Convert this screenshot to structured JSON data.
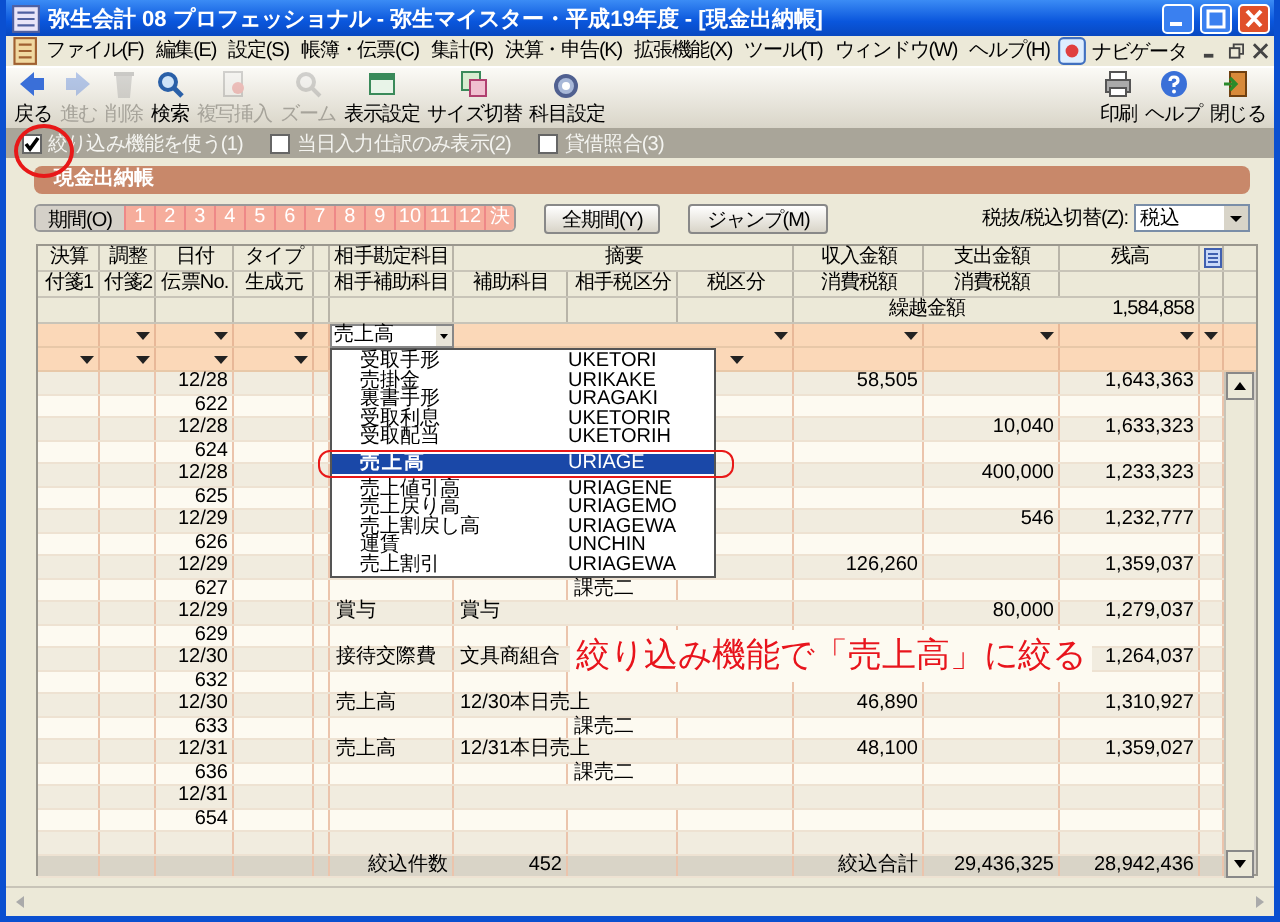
{
  "window": {
    "title": "弥生会計 08 プロフェッショナル - 弥生マイスター・平成19年度 - [現金出納帳]"
  },
  "menu": [
    "ファイル(F)",
    "編集(E)",
    "設定(S)",
    "帳簿・伝票(C)",
    "集計(R)",
    "決算・申告(K)",
    "拡張機能(X)",
    "ツール(T)",
    "ウィンドウ(W)",
    "ヘルプ(H)"
  ],
  "navigator": "ナビゲータ",
  "toolbar": [
    {
      "label": "戻る",
      "disabled": false
    },
    {
      "label": "進む",
      "disabled": true
    },
    {
      "label": "削除",
      "disabled": true
    },
    {
      "label": "検索",
      "disabled": false
    },
    {
      "label": "複写挿入",
      "disabled": true
    },
    {
      "label": "ズーム",
      "disabled": true
    },
    {
      "label": "表示設定",
      "disabled": false
    },
    {
      "label": "サイズ切替",
      "disabled": false
    },
    {
      "label": "科目設定",
      "disabled": false
    }
  ],
  "toolbar_right": [
    {
      "label": "印刷",
      "disabled": false
    },
    {
      "label": "ヘルプ",
      "disabled": false
    },
    {
      "label": "閉じる",
      "disabled": false
    }
  ],
  "options": [
    {
      "label": "絞り込み機能を使う(1)",
      "checked": true
    },
    {
      "label": "当日入力仕訳のみ表示(2)",
      "checked": false
    },
    {
      "label": "貸借照合(3)",
      "checked": false
    }
  ],
  "ledger_title": "現金出納帳",
  "period": {
    "label": "期間(O)",
    "months": [
      "1",
      "2",
      "3",
      "4",
      "5",
      "6",
      "7",
      "8",
      "9",
      "10",
      "11",
      "12",
      "決"
    ]
  },
  "period_buttons": [
    "全期間(Y)",
    "ジャンプ(M)"
  ],
  "tax_switch": {
    "label": "税抜/税込切替(Z):",
    "value": "税込"
  },
  "table": {
    "columns": [
      {
        "top": "決算",
        "bottom": "付箋1"
      },
      {
        "top": "調整",
        "bottom": "付箋2"
      },
      {
        "top": "日付",
        "bottom": "伝票No."
      },
      {
        "top": "タイプ",
        "bottom": "生成元"
      },
      {
        "top": "相手勘定科目",
        "bottom": "相手補助科目"
      },
      {
        "top": "摘要",
        "subs": [
          "補助科目",
          "相手税区分",
          "税区分"
        ]
      },
      {
        "top": "収入金額",
        "bottom": "消費税額"
      },
      {
        "top": "支出金額",
        "bottom": "消費税額"
      },
      {
        "top": "残高"
      }
    ],
    "carry_label": "繰越金額",
    "carry_balance": "1,584,858",
    "filter_value": "売上高",
    "rows": [
      {
        "date": "12/28",
        "no": "622",
        "income": "58,505",
        "balance": "1,643,363"
      },
      {
        "date": "12/28",
        "no": "624",
        "expense": "10,040",
        "balance": "1,633,323"
      },
      {
        "date": "12/28",
        "no": "625",
        "expense": "400,000",
        "balance": "1,233,323"
      },
      {
        "date": "12/29",
        "no": "626",
        "expense": "546",
        "balance": "1,232,777"
      },
      {
        "date": "12/29",
        "no": "627",
        "tax": "課売二",
        "income": "126,260",
        "balance": "1,359,037"
      },
      {
        "date": "12/29",
        "no": "629",
        "account": "賞与",
        "summary": "賞与",
        "expense": "80,000",
        "balance": "1,279,037"
      },
      {
        "date": "12/30",
        "no": "632",
        "account": "接待交際費",
        "summary": "文具商組合",
        "balance": "1,264,037"
      },
      {
        "date": "12/30",
        "no": "633",
        "account": "売上高",
        "summary": "12/30本日売上",
        "tax": "課売二",
        "income": "46,890",
        "balance": "1,310,927"
      },
      {
        "date": "12/31",
        "no": "636",
        "account": "売上高",
        "summary": "12/31本日売上",
        "tax": "課売二",
        "income": "48,100",
        "balance": "1,359,027"
      },
      {
        "date": "12/31",
        "no": "654"
      }
    ],
    "totals": {
      "count_label": "絞込件数",
      "count": "452",
      "sum_label": "絞込合計",
      "income": "29,436,325",
      "expense": "28,942,436"
    }
  },
  "account_dropdown": {
    "options": [
      {
        "name": "受取手形",
        "code": "UKETORI",
        "selected": false
      },
      {
        "name": "売掛金",
        "code": "URIKAKE",
        "selected": false
      },
      {
        "name": "裏書手形",
        "code": "URAGAKI",
        "selected": false
      },
      {
        "name": "受取利息",
        "code": "UKETORIR",
        "selected": false
      },
      {
        "name": "受取配当",
        "code": "UKETORIH",
        "selected": false
      },
      {
        "name": "売上高",
        "code": "URIAGE",
        "selected": true
      },
      {
        "name": "売上値引高",
        "code": "URIAGENE",
        "selected": false
      },
      {
        "name": "売上戻り高",
        "code": "URIAGEMO",
        "selected": false
      },
      {
        "name": "売上割戻し高",
        "code": "URIAGEWA",
        "selected": false
      },
      {
        "name": "運賃",
        "code": "UNCHIN",
        "selected": false
      },
      {
        "name": "売上割引",
        "code": "URIAGEWA",
        "selected": false
      }
    ]
  },
  "annotation": "絞り込み機能で「売上高」に絞る"
}
